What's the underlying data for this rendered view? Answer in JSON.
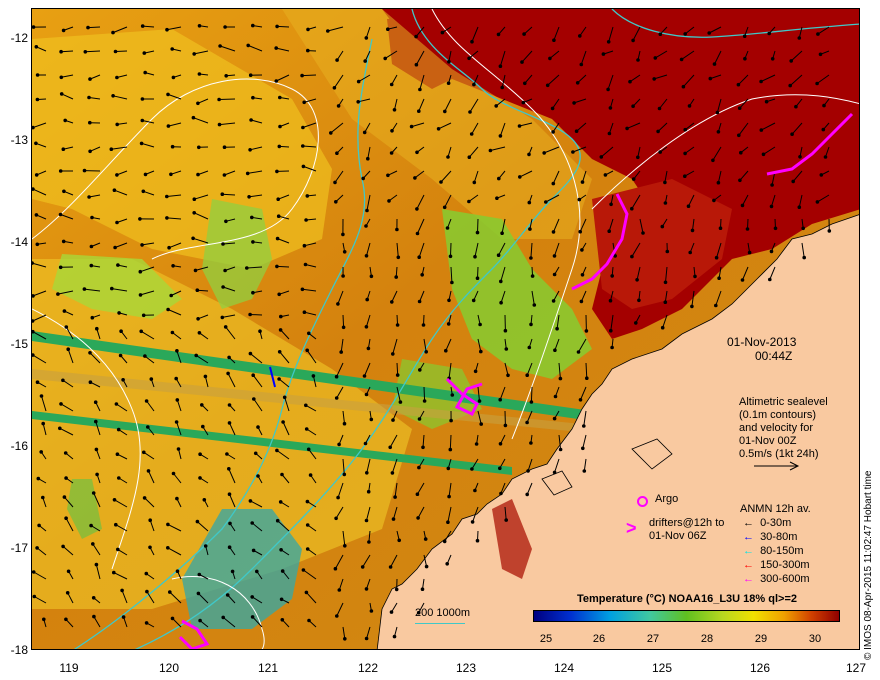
{
  "axes": {
    "lat_ticks": [
      "-12",
      "-13",
      "-14",
      "-15",
      "-16",
      "-17",
      "-18"
    ],
    "lon_ticks": [
      "119",
      "120",
      "121",
      "122",
      "123",
      "124",
      "125",
      "126",
      "127"
    ]
  },
  "timestamp": {
    "date": "01-Nov-2013",
    "time": "00:44Z"
  },
  "altimetry_note": [
    "Altimetric sealevel",
    "(0.1m contours)",
    "and velocity for",
    "01-Nov 00Z",
    "0.5m/s (1kt 24h)"
  ],
  "argo_label": "Argo",
  "drifters_label": [
    "drifters@12h to",
    "01-Nov 06Z"
  ],
  "anmn_title": "ANMN 12h av.",
  "anmn_ranges": [
    {
      "label": "0-30m",
      "color": "#000000"
    },
    {
      "label": "30-80m",
      "color": "#0000ff"
    },
    {
      "label": "80-150m",
      "color": "#00e5e5"
    },
    {
      "label": "150-300m",
      "color": "#ff0000"
    },
    {
      "label": "300-600m",
      "color": "#ff00ff"
    }
  ],
  "depth_contours_label": "200  1000m",
  "colorbar": {
    "title": "Temperature (°C) NOAA16_L3U 18% ql>=2",
    "ticks": [
      "25",
      "26",
      "27",
      "28",
      "29",
      "30"
    ],
    "range": [
      24.6,
      30.7
    ]
  },
  "credit": "© IMOS 08-Apr-2015 11:02:47 Hobart time",
  "colors": {
    "land": "#f9c9a0",
    "warm_water": "#a40000",
    "mid_water": "#e09a10",
    "cool_water": "#86cc30",
    "drifters": "#ff00ff",
    "altimetry_contours": "#ffffff",
    "bathymetry": "#40c8c8"
  }
}
